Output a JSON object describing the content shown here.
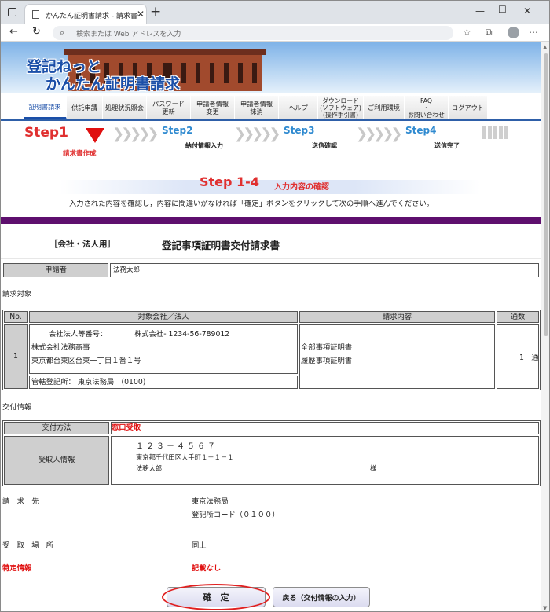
{
  "browser": {
    "tab_title": "かんたん証明書請求 - 請求書作成",
    "address_placeholder": "検索または Web アドレスを入力"
  },
  "banner": {
    "line1": "登記ねっと",
    "line2": "かんたん証明書請求"
  },
  "menu": {
    "items": [
      {
        "label": "証明書請求"
      },
      {
        "label": "供託申請"
      },
      {
        "label": "処理状況照会"
      },
      {
        "label": "パスワード\n更新"
      },
      {
        "label": "申請者情報\n変更"
      },
      {
        "label": "申請者情報\n抹消"
      },
      {
        "label": "ヘルプ"
      },
      {
        "label": "ダウンロード\n(ソフトウェア)\n(操作手引書)"
      },
      {
        "label": "ご利用環境"
      },
      {
        "label": "FAQ\n・\nお問い合わせ"
      },
      {
        "label": "ログアウト"
      }
    ]
  },
  "steps": {
    "step1": "Step1",
    "step1_sub": "請求書作成",
    "step2": "Step2",
    "step2_sub": "納付情報入力",
    "step3": "Step3",
    "step3_sub": "送信確認",
    "step4": "Step4",
    "step4_sub": "送信完了"
  },
  "step_header": {
    "title": "Step 1-4",
    "subtitle": "入力内容の確認",
    "instruction": "入力された内容を確認し，内容に間違いがなければ「確定」ボタンをクリックして次の手順へ進んでください。"
  },
  "form": {
    "type_label": "［会社・法人用］",
    "title": "登記事項証明書交付請求書",
    "applicant_label": "申請者",
    "applicant_value": "法務太郎",
    "target_heading": "請求対象",
    "table_headers": {
      "no": "No.",
      "company": "対象会社／法人",
      "content": "請求内容",
      "copies": "通数"
    },
    "row": {
      "no": "1",
      "corp_id_label": "会社法人等番号：",
      "corp_id_value": "株式会社- 1234-56-789012",
      "company_name": "株式会社法務商事",
      "company_address": "東京都台東区台東一丁目１番１号",
      "jurisdiction": "管轄登記所： 東京法務局　(0100)",
      "content_1": "全部事項証明書",
      "content_2": "履歴事項証明書",
      "copies": "1　通"
    },
    "delivery_heading": "交付情報",
    "delivery_method_label": "交付方法",
    "delivery_method_value": "窓口受取",
    "recipient_label": "受取人情報",
    "recipient_postal": "１２３－４５６７",
    "recipient_address": "東京都千代田区大手町１－１－１",
    "recipient_name": "法務太郎",
    "recipient_honorific": "様",
    "billing_label": "請　求　先",
    "billing_value": "東京法務局",
    "billing_code": "登記所コード（０１００）",
    "pickup_label": "受　取　場　所",
    "pickup_value": "同上",
    "special_label": "特定情報",
    "special_value": "記載なし"
  },
  "buttons": {
    "confirm": "確　定",
    "back": "戻る（交付情報の入力）"
  },
  "colors": {
    "accent_blue": "#1b4fa8",
    "step_red": "#e03030",
    "purple_bar": "#5e0f6e"
  }
}
